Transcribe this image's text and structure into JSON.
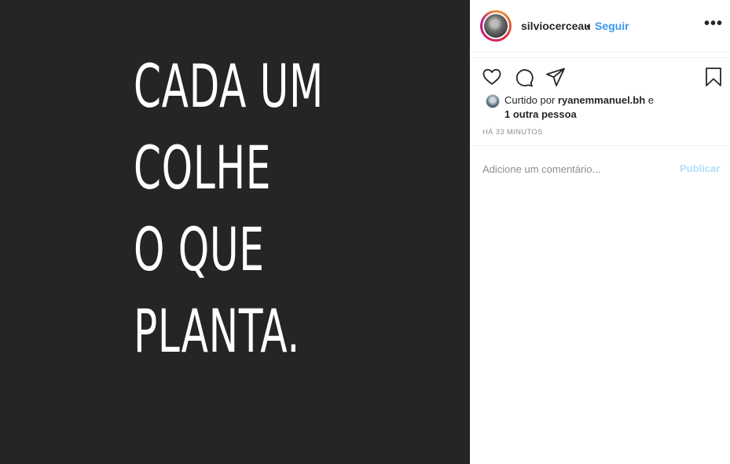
{
  "post": {
    "image_text": [
      "CADA UM",
      "COLHE",
      "O QUE",
      "PLANTA."
    ],
    "background_color": "#252525"
  },
  "header": {
    "username": "silviocerceau",
    "separator": "•",
    "follow_label": "Seguir",
    "more_label": "•••"
  },
  "actions": {
    "icons": [
      "heart-icon",
      "comment-icon",
      "share-icon",
      "bookmark-icon"
    ]
  },
  "likes": {
    "prefix": "Curtido por ",
    "user": "ryanemmanuel.bh",
    "connector": " e",
    "others": "1 outra pessoa"
  },
  "timestamp": "HÁ 33 MINUTOS",
  "comment": {
    "placeholder": "Adicione um comentário...",
    "value": "",
    "publish_label": "Publicar"
  },
  "colors": {
    "link": "#3897f0",
    "publish_disabled": "#b2dffc",
    "muted": "#8e8e8e"
  }
}
